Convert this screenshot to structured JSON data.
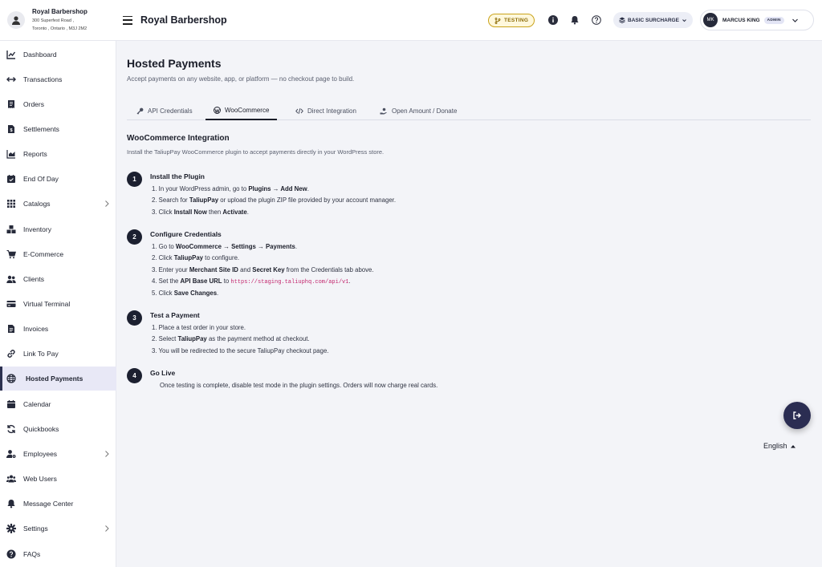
{
  "business": {
    "name": "Royal Barbershop",
    "address_line1": "300 Superfest Road ,",
    "address_line2": "Toronto , Ontario , M3J 2M2"
  },
  "header": {
    "title": "Royal Barbershop",
    "env_badge": "TESTING",
    "surcharge_label": "BASIC SURCHARGE",
    "user_initials": "MK",
    "user_name": "MARCUS KING",
    "user_role": "ADMIN"
  },
  "sidebar": {
    "items": [
      {
        "label": "Dashboard",
        "icon": "chart-line-icon"
      },
      {
        "label": "Transactions",
        "icon": "arrows-horizontal-icon"
      },
      {
        "label": "Orders",
        "icon": "receipt-icon"
      },
      {
        "label": "Settlements",
        "icon": "document-dollar-icon"
      },
      {
        "label": "Reports",
        "icon": "bar-chart-icon"
      },
      {
        "label": "End Of Day",
        "icon": "calendar-check-icon"
      },
      {
        "label": "Catalogs",
        "icon": "grid-icon"
      },
      {
        "label": "Inventory",
        "icon": "boxes-icon"
      },
      {
        "label": "E-Commerce",
        "icon": "cart-icon"
      },
      {
        "label": "Clients",
        "icon": "users-icon"
      },
      {
        "label": "Virtual Terminal",
        "icon": "credit-card-icon"
      },
      {
        "label": "Invoices",
        "icon": "invoice-icon"
      },
      {
        "label": "Link To Pay",
        "icon": "link-icon"
      },
      {
        "label": "Hosted Payments",
        "icon": "globe-icon"
      },
      {
        "label": "Calendar",
        "icon": "calendar-icon"
      },
      {
        "label": "Quickbooks",
        "icon": "sync-icon"
      },
      {
        "label": "Employees",
        "icon": "user-gear-icon"
      },
      {
        "label": "Web Users",
        "icon": "user-group-icon"
      },
      {
        "label": "Message Center",
        "icon": "bell-icon"
      },
      {
        "label": "Settings",
        "icon": "gear-icon"
      },
      {
        "label": "FAQs",
        "icon": "question-icon"
      }
    ]
  },
  "page": {
    "title": "Hosted Payments",
    "subtitle": "Accept payments on any website, app, or platform — no checkout page to build."
  },
  "tabs": [
    {
      "label": "API Credentials",
      "icon": "key-icon"
    },
    {
      "label": "WooCommerce",
      "icon": "wordpress-icon"
    },
    {
      "label": "Direct Integration",
      "icon": "code-icon"
    },
    {
      "label": "Open Amount / Donate",
      "icon": "hand-coin-icon"
    }
  ],
  "integration": {
    "title": "WooCommerce Integration",
    "subtitle": "Install the TaliupPay WooCommerce plugin to accept payments directly in your WordPress store."
  },
  "steps": [
    {
      "num": "1",
      "title": "Install the Plugin",
      "lines": [
        [
          "1. In your WordPress admin, go to ",
          {
            "b": "Plugins → Add New"
          },
          "."
        ],
        [
          "2. Search for ",
          {
            "b": "TaliupPay"
          },
          " or upload the plugin ZIP file provided by your account manager."
        ],
        [
          "3. Click ",
          {
            "b": "Install Now"
          },
          " then ",
          {
            "b": "Activate"
          },
          "."
        ]
      ]
    },
    {
      "num": "2",
      "title": "Configure Credentials",
      "lines": [
        [
          "1. Go to ",
          {
            "b": "WooCommerce → Settings → Payments"
          },
          "."
        ],
        [
          "2. Click ",
          {
            "b": "TaliupPay"
          },
          " to configure."
        ],
        [
          "3. Enter your ",
          {
            "b": "Merchant Site ID"
          },
          " and ",
          {
            "b": "Secret Key"
          },
          " from the Credentials tab above."
        ],
        [
          "4. Set the ",
          {
            "b": "API Base URL"
          },
          " to ",
          {
            "code": "https://staging.taliuphq.com/api/v1"
          },
          "."
        ],
        [
          "5. Click ",
          {
            "b": "Save Changes"
          },
          "."
        ]
      ]
    },
    {
      "num": "3",
      "title": "Test a Payment",
      "lines": [
        [
          "1. Place a test order in your store."
        ],
        [
          "2. Select ",
          {
            "b": "TaliupPay"
          },
          " as the payment method at checkout."
        ],
        [
          "3. You will be redirected to the secure TaliupPay checkout page."
        ]
      ]
    },
    {
      "num": "4",
      "title": "Go Live",
      "lines": [
        [
          "Once testing is complete, disable test mode in the plugin settings. Orders will now charge real cards."
        ]
      ]
    }
  ],
  "footer": {
    "language": "English"
  }
}
